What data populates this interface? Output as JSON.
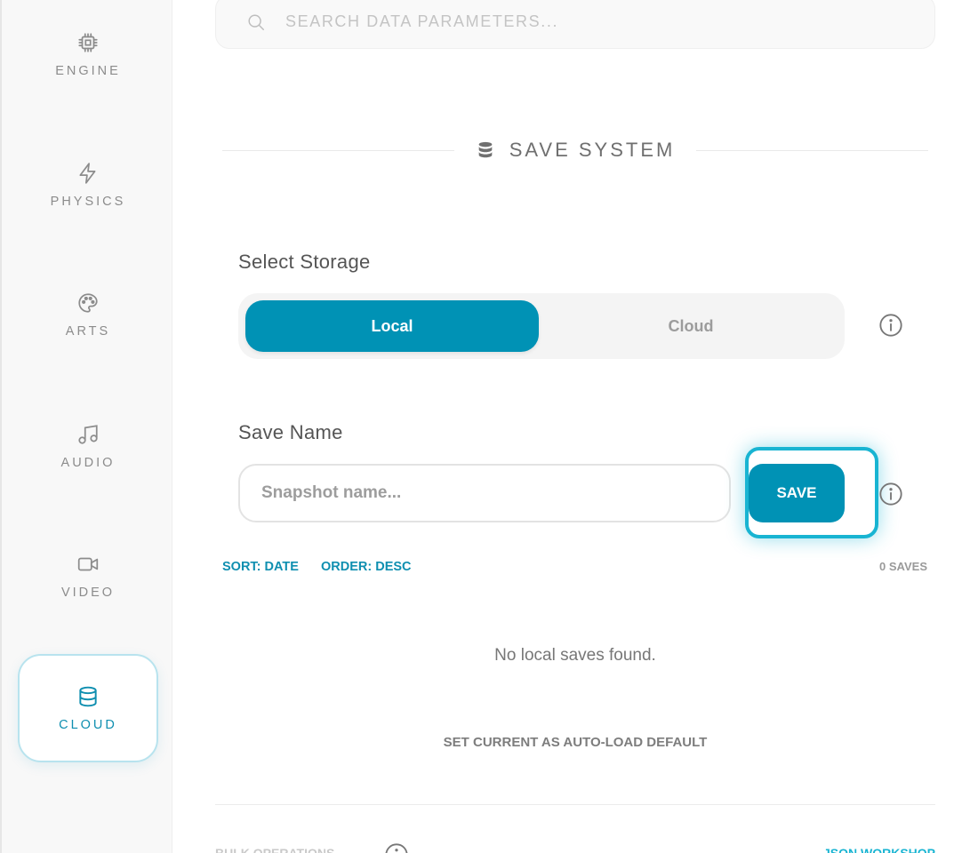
{
  "sidebar": {
    "items": [
      {
        "label": "ENGINE",
        "icon": "cpu-icon",
        "active": false
      },
      {
        "label": "PHYSICS",
        "icon": "lightning-icon",
        "active": false
      },
      {
        "label": "ARTS",
        "icon": "palette-icon",
        "active": false
      },
      {
        "label": "AUDIO",
        "icon": "music-note-icon",
        "active": false
      },
      {
        "label": "VIDEO",
        "icon": "video-camera-icon",
        "active": false
      },
      {
        "label": "CLOUD",
        "icon": "database-icon",
        "active": true
      }
    ]
  },
  "search": {
    "placeholder": "SEARCH DATA PARAMETERS...",
    "value": ""
  },
  "section": {
    "title": "SAVE SYSTEM",
    "icon": "database-icon"
  },
  "storage": {
    "label": "Select Storage",
    "options": [
      "Local",
      "Cloud"
    ],
    "selected": "Local"
  },
  "save_name": {
    "label": "Save Name",
    "placeholder": "Snapshot name...",
    "value": "",
    "button": "SAVE"
  },
  "list": {
    "sort": "SORT: DATE",
    "order": "ORDER: DESC",
    "count": "0 SAVES",
    "empty_message": "No local saves found.",
    "autoload": "SET CURRENT AS AUTO-LOAD DEFAULT"
  },
  "footer": {
    "left": "BULK OPERATIONS",
    "right": "JSON WORKSHOP"
  },
  "colors": {
    "accent": "#0092b5",
    "accent_light": "#18b4d2",
    "muted": "#8c8c8c",
    "sidebar_bg": "#f8f8f8"
  }
}
